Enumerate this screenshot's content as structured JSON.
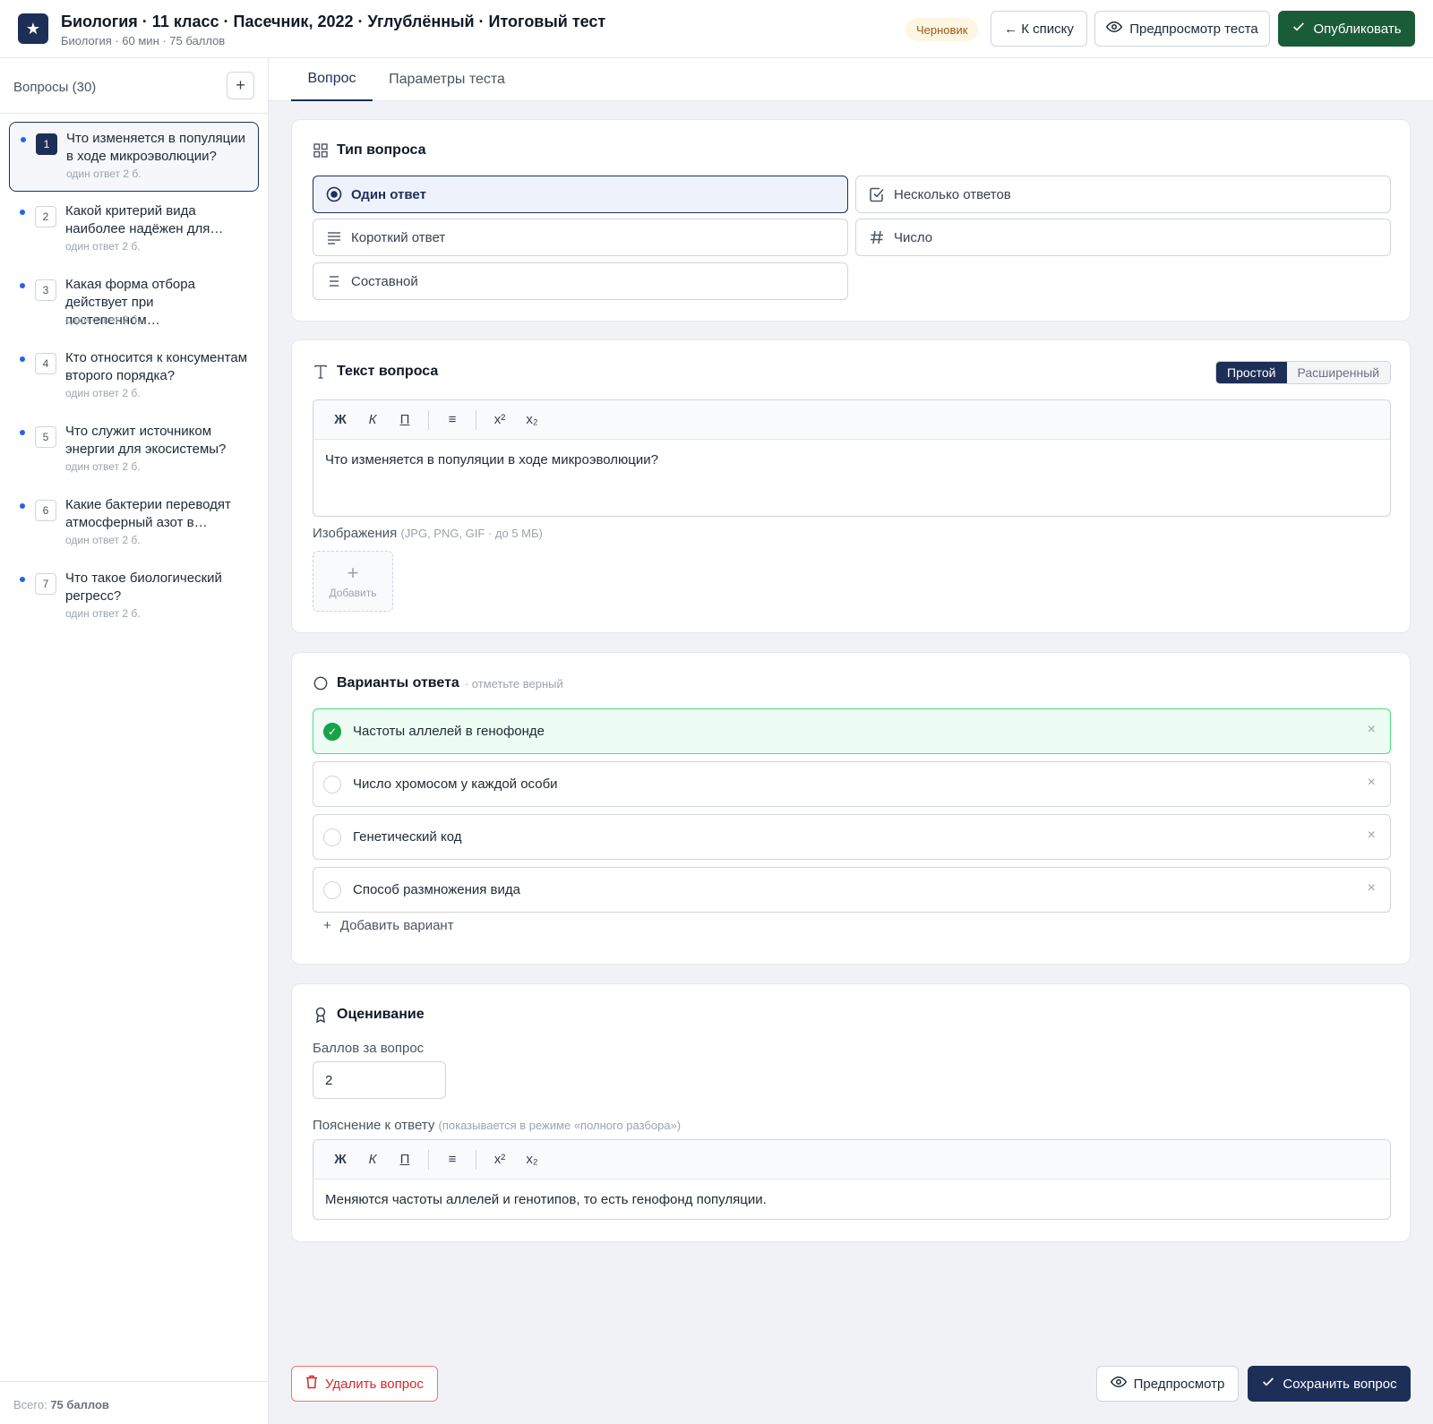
{
  "header": {
    "logo_glyph": "★",
    "title": "Биология · 11 класс · Пасечник, 2022 · Углублённый · Итоговый тест",
    "subtitle": "Биология · 60 мин · 75 баллов",
    "status_badge": "Черновик",
    "back_label": "← К списку",
    "preview_label": "Предпросмотр теста",
    "publish_label": "Опубликовать"
  },
  "sidebar": {
    "heading": "Вопросы (30)",
    "add_icon": "plus-icon",
    "items": [
      {
        "num": "1",
        "text": "Что изменяется в популяции в ходе микроэволюции?",
        "meta": "один ответ  2 б."
      },
      {
        "num": "2",
        "text": "Какой критерий вида наиболее надёжен для…",
        "meta": "один ответ  2 б."
      },
      {
        "num": "3",
        "text": "Какая форма отбора действует при постепенном…",
        "meta": "один ответ  2 б."
      },
      {
        "num": "4",
        "text": "Кто относится к консументам второго порядка?",
        "meta": "один ответ  2 б."
      },
      {
        "num": "5",
        "text": "Что служит источником энергии для экосистемы?",
        "meta": "один ответ  2 б."
      },
      {
        "num": "6",
        "text": "Какие бактерии переводят атмосферный азот в…",
        "meta": "один ответ  2 б."
      },
      {
        "num": "7",
        "text": "Что такое биологический регресс?",
        "meta": "один ответ  2 б."
      }
    ],
    "total_prefix": "Всего: ",
    "total_value": "75 баллов"
  },
  "tabs": {
    "question": "Вопрос",
    "params": "Параметры теста"
  },
  "question_type": {
    "title": "Тип вопроса",
    "options": [
      {
        "label": "Один ответ",
        "icon": "radio-target-icon"
      },
      {
        "label": "Несколько ответов",
        "icon": "checkbox-icon"
      },
      {
        "label": "Короткий ответ",
        "icon": "lines-icon"
      },
      {
        "label": "Число",
        "icon": "hash-icon"
      },
      {
        "label": "Составной",
        "icon": "list-icon"
      }
    ]
  },
  "question_text": {
    "title": "Текст вопроса",
    "mode_simple": "Простой",
    "mode_advanced": "Расширенный",
    "toolbar": {
      "bold": "Ж",
      "italic": "К",
      "underline": "П",
      "list": "≡",
      "sup": "x²",
      "sub": "x₂"
    },
    "content": "Что изменяется в популяции в ходе микроэволюции?",
    "images_label": "Изображения",
    "images_hint": "(JPG, PNG, GIF · до 5 МБ)",
    "add_image_label": "Добавить"
  },
  "answers": {
    "title": "Варианты ответа",
    "hint": "· отметьте верный",
    "items": [
      {
        "text": "Частоты аллелей в генофонде",
        "correct": true
      },
      {
        "text": "Число хромосом у каждой особи",
        "correct": false
      },
      {
        "text": "Генетический код",
        "correct": false
      },
      {
        "text": "Способ размножения вида",
        "correct": false
      }
    ],
    "add_label": "Добавить вариант"
  },
  "grading": {
    "title": "Оценивание",
    "points_label": "Баллов за вопрос",
    "points_value": "2",
    "explanation_label": "Пояснение к ответу",
    "explanation_hint": "(показывается в режиме «полного разбора»)",
    "explanation_text": "Меняются частоты аллелей и генотипов, то есть генофонд популяции."
  },
  "footer": {
    "delete_label": "Удалить вопрос",
    "preview_label": "Предпросмотр",
    "save_label": "Сохранить вопрос"
  },
  "colors": {
    "brand": "#1e2f57",
    "publish": "#1a5c37",
    "correct": "#16a34a",
    "danger": "#dc2626"
  }
}
